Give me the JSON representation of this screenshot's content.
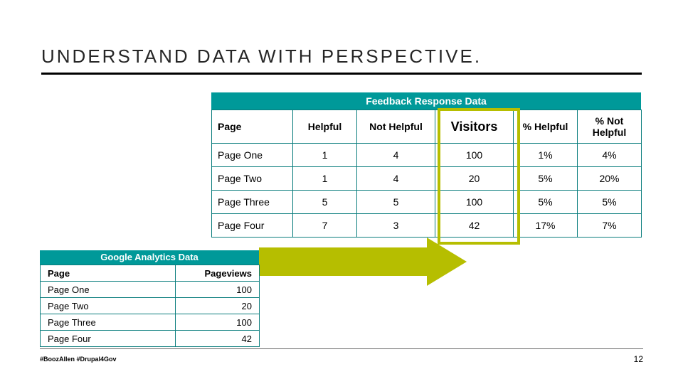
{
  "title": "UNDERSTAND DATA WITH PERSPECTIVE.",
  "feedback": {
    "banner": "Feedback Response Data",
    "headers": {
      "page": "Page",
      "helpful": "Helpful",
      "not_helpful": "Not Helpful",
      "visitors": "Visitors",
      "pct_helpful": "% Helpful",
      "pct_not_helpful": "% Not Helpful"
    },
    "rows": [
      {
        "page": "Page One",
        "helpful": "1",
        "not_helpful": "4",
        "visitors": "100",
        "pct_helpful": "1%",
        "pct_not_helpful": "4%"
      },
      {
        "page": "Page Two",
        "helpful": "1",
        "not_helpful": "4",
        "visitors": "20",
        "pct_helpful": "5%",
        "pct_not_helpful": "20%"
      },
      {
        "page": "Page Three",
        "helpful": "5",
        "not_helpful": "5",
        "visitors": "100",
        "pct_helpful": "5%",
        "pct_not_helpful": "5%"
      },
      {
        "page": "Page Four",
        "helpful": "7",
        "not_helpful": "3",
        "visitors": "42",
        "pct_helpful": "17%",
        "pct_not_helpful": "7%"
      }
    ]
  },
  "ga": {
    "banner": "Google Analytics Data",
    "headers": {
      "page": "Page",
      "pageviews": "Pageviews"
    },
    "rows": [
      {
        "page": "Page One",
        "pageviews": "100"
      },
      {
        "page": "Page Two",
        "pageviews": "20"
      },
      {
        "page": "Page Three",
        "pageviews": "100"
      },
      {
        "page": "Page Four",
        "pageviews": "42"
      }
    ]
  },
  "footer": {
    "hashtag": "#BoozAllen #Drupal4Gov",
    "page_number": "12"
  },
  "chart_data": [
    {
      "type": "table",
      "title": "Feedback Response Data",
      "columns": [
        "Page",
        "Helpful",
        "Not Helpful",
        "Visitors",
        "% Helpful",
        "% Not Helpful"
      ],
      "rows": [
        [
          "Page One",
          1,
          4,
          100,
          "1%",
          "4%"
        ],
        [
          "Page Two",
          1,
          4,
          20,
          "5%",
          "20%"
        ],
        [
          "Page Three",
          5,
          5,
          100,
          "5%",
          "5%"
        ],
        [
          "Page Four",
          7,
          3,
          42,
          "17%",
          "7%"
        ]
      ]
    },
    {
      "type": "table",
      "title": "Google Analytics Data",
      "columns": [
        "Page",
        "Pageviews"
      ],
      "rows": [
        [
          "Page One",
          100
        ],
        [
          "Page Two",
          20
        ],
        [
          "Page Three",
          100
        ],
        [
          "Page Four",
          42
        ]
      ]
    }
  ]
}
